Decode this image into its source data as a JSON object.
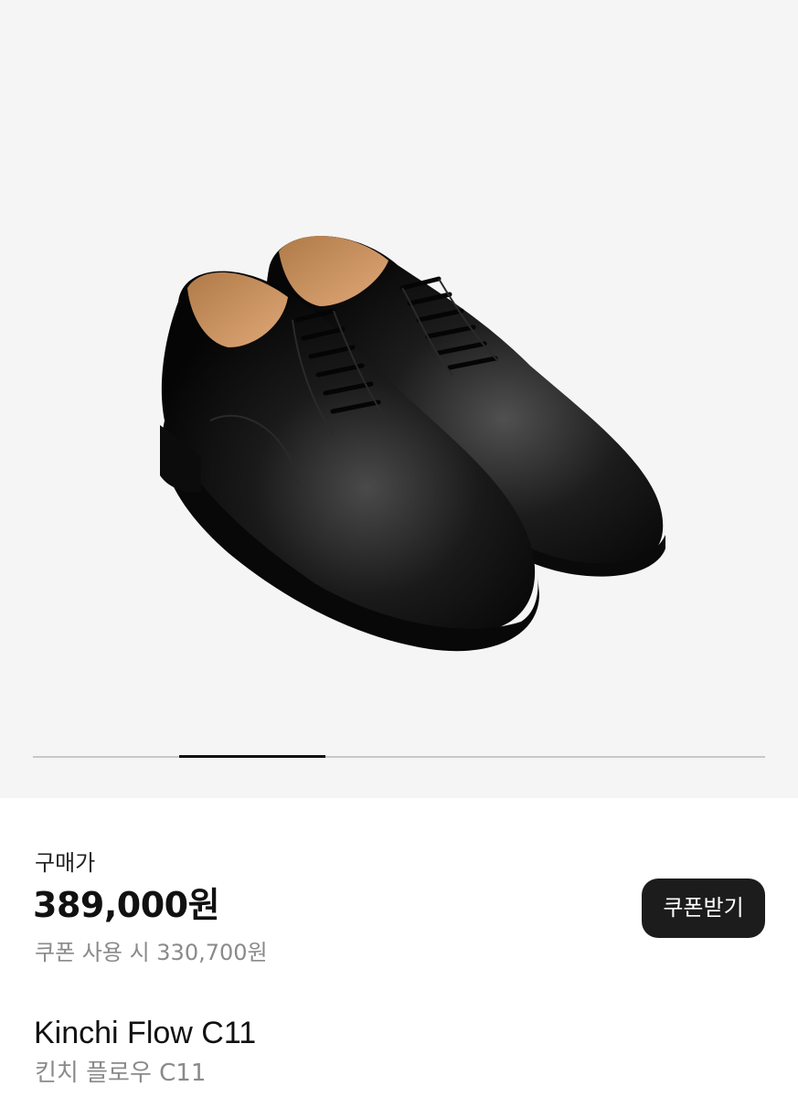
{
  "gallery": {
    "image_icon": "black-leather-derby-shoes-image",
    "pager_total": 5,
    "pager_current": 2
  },
  "pricing": {
    "label": "구매가",
    "price": "389,000원",
    "coupon_price": "쿠폰 사용 시 330,700원",
    "coupon_button_label": "쿠폰받기"
  },
  "product": {
    "name": "Kinchi Flow C11",
    "name_ko": "킨치 플로우 C11"
  },
  "colors": {
    "gallery_background": "#f5f5f5",
    "button_background": "#1c1c1c",
    "muted_text": "#8a8a8a"
  }
}
